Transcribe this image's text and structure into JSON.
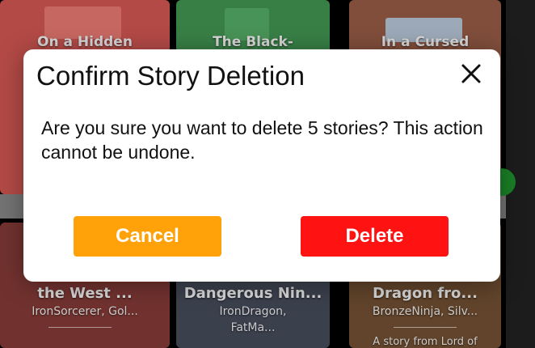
{
  "colors": {
    "cancel_bg": "#ffa20a",
    "delete_bg": "#ff1212",
    "card1": "#c34a46",
    "card2": "#3c7f48",
    "card3": "#8a4f3a",
    "card4": "#7c3a34",
    "card5": "#444a57",
    "card6": "#6b4a2e",
    "check": "#1d8a2a"
  },
  "background": {
    "top_cards": [
      {
        "title": "On a Hidden"
      },
      {
        "title": "The Black-"
      },
      {
        "title": "In a Cursed"
      }
    ],
    "bottom_cards": [
      {
        "title": "the West ...",
        "author": "IronSorcerer, Gol..."
      },
      {
        "title": "Dangerous Nin...",
        "author": "IronDragon,",
        "author2": "FatMa..."
      },
      {
        "title": "Dragon fro...",
        "author": "BronzeNinja, Silv...",
        "blurb": "A story from Lord of"
      }
    ]
  },
  "dialog": {
    "title": "Confirm Story Deletion",
    "message": "Are you sure you want to delete 5 stories? This action cannot be undone.",
    "cancel_label": "Cancel",
    "delete_label": "Delete",
    "close_icon": "close-icon"
  }
}
